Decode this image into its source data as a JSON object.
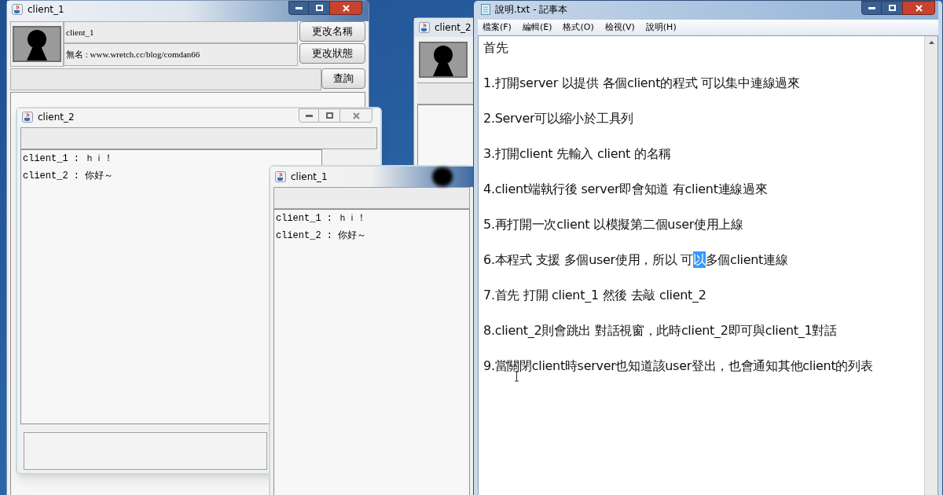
{
  "client_1_main": {
    "title": "client_1",
    "name_field": "client_1",
    "status_field": "無名 : www.wretch.cc/blog/comdan66",
    "buttons": [
      "更改名稱",
      "更改狀態",
      "查詢"
    ]
  },
  "client_2_main": {
    "title": "client_2"
  },
  "client_2_chat": {
    "title": "client_2",
    "messages": [
      "client_1 : ｈｉ！",
      "client_2 : 你好～"
    ]
  },
  "client_1_chat": {
    "title": "client_1",
    "messages": [
      "client_1 : ｈｉ！",
      "client_2 : 你好～"
    ]
  },
  "notepad": {
    "title": "說明.txt - 記事本",
    "menu": [
      "檔案(F)",
      "編輯(E)",
      "格式(O)",
      "檢視(V)",
      "說明(H)"
    ],
    "lines": [
      {
        "parts": [
          {
            "text": "首先",
            "selected": false
          }
        ]
      },
      {
        "parts": [
          {
            "text": "1.打開server 以提供 各個client的程式 可以集中連線過來",
            "selected": false
          }
        ]
      },
      {
        "parts": [
          {
            "text": "2.Server可以縮小於工具列",
            "selected": false
          }
        ]
      },
      {
        "parts": [
          {
            "text": "3.打開client 先輸入 client 的名稱",
            "selected": false
          }
        ]
      },
      {
        "parts": [
          {
            "text": "4.client端執行後 server即會知道 有client連線過來",
            "selected": false
          }
        ]
      },
      {
        "parts": [
          {
            "text": "5.再打開一次client 以模擬第二個user使用上線",
            "selected": false
          }
        ]
      },
      {
        "parts": [
          {
            "text": "6.本程式 支援 多個user使用，所以 可",
            "selected": false
          },
          {
            "text": "以",
            "selected": true
          },
          {
            "text": "多個client連線",
            "selected": false
          }
        ]
      },
      {
        "parts": [
          {
            "text": "7.首先 打開 client_1 然後 去敲 client_2",
            "selected": false
          }
        ]
      },
      {
        "parts": [
          {
            "text": "8.client_2則會跳出 對話視窗，此時client_2即可與client_1對話",
            "selected": false
          }
        ]
      },
      {
        "parts": [
          {
            "text": "9.當關閉client時server也知道該user登出，也會通知其他client的列表",
            "selected": false
          }
        ]
      }
    ]
  }
}
